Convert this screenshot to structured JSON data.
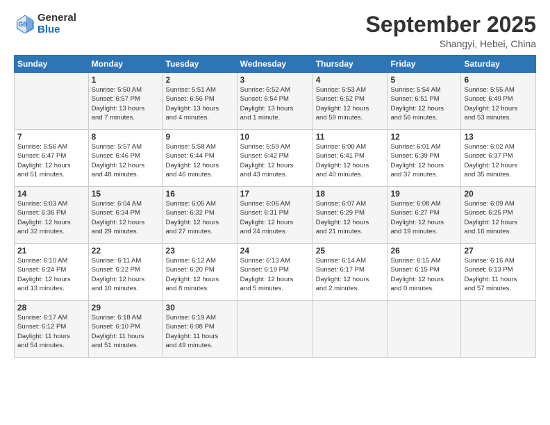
{
  "header": {
    "logo": {
      "general": "General",
      "blue": "Blue"
    },
    "title": "September 2025",
    "subtitle": "Shangyi, Hebei, China"
  },
  "weekdays": [
    "Sunday",
    "Monday",
    "Tuesday",
    "Wednesday",
    "Thursday",
    "Friday",
    "Saturday"
  ],
  "weeks": [
    [
      {
        "day": "",
        "info": ""
      },
      {
        "day": "1",
        "info": "Sunrise: 5:50 AM\nSunset: 6:57 PM\nDaylight: 13 hours\nand 7 minutes."
      },
      {
        "day": "2",
        "info": "Sunrise: 5:51 AM\nSunset: 6:56 PM\nDaylight: 13 hours\nand 4 minutes."
      },
      {
        "day": "3",
        "info": "Sunrise: 5:52 AM\nSunset: 6:54 PM\nDaylight: 13 hours\nand 1 minute."
      },
      {
        "day": "4",
        "info": "Sunrise: 5:53 AM\nSunset: 6:52 PM\nDaylight: 12 hours\nand 59 minutes."
      },
      {
        "day": "5",
        "info": "Sunrise: 5:54 AM\nSunset: 6:51 PM\nDaylight: 12 hours\nand 56 minutes."
      },
      {
        "day": "6",
        "info": "Sunrise: 5:55 AM\nSunset: 6:49 PM\nDaylight: 12 hours\nand 53 minutes."
      }
    ],
    [
      {
        "day": "7",
        "info": "Sunrise: 5:56 AM\nSunset: 6:47 PM\nDaylight: 12 hours\nand 51 minutes."
      },
      {
        "day": "8",
        "info": "Sunrise: 5:57 AM\nSunset: 6:46 PM\nDaylight: 12 hours\nand 48 minutes."
      },
      {
        "day": "9",
        "info": "Sunrise: 5:58 AM\nSunset: 6:44 PM\nDaylight: 12 hours\nand 46 minutes."
      },
      {
        "day": "10",
        "info": "Sunrise: 5:59 AM\nSunset: 6:42 PM\nDaylight: 12 hours\nand 43 minutes."
      },
      {
        "day": "11",
        "info": "Sunrise: 6:00 AM\nSunset: 6:41 PM\nDaylight: 12 hours\nand 40 minutes."
      },
      {
        "day": "12",
        "info": "Sunrise: 6:01 AM\nSunset: 6:39 PM\nDaylight: 12 hours\nand 37 minutes."
      },
      {
        "day": "13",
        "info": "Sunrise: 6:02 AM\nSunset: 6:37 PM\nDaylight: 12 hours\nand 35 minutes."
      }
    ],
    [
      {
        "day": "14",
        "info": "Sunrise: 6:03 AM\nSunset: 6:36 PM\nDaylight: 12 hours\nand 32 minutes."
      },
      {
        "day": "15",
        "info": "Sunrise: 6:04 AM\nSunset: 6:34 PM\nDaylight: 12 hours\nand 29 minutes."
      },
      {
        "day": "16",
        "info": "Sunrise: 6:05 AM\nSunset: 6:32 PM\nDaylight: 12 hours\nand 27 minutes."
      },
      {
        "day": "17",
        "info": "Sunrise: 6:06 AM\nSunset: 6:31 PM\nDaylight: 12 hours\nand 24 minutes."
      },
      {
        "day": "18",
        "info": "Sunrise: 6:07 AM\nSunset: 6:29 PM\nDaylight: 12 hours\nand 21 minutes."
      },
      {
        "day": "19",
        "info": "Sunrise: 6:08 AM\nSunset: 6:27 PM\nDaylight: 12 hours\nand 19 minutes."
      },
      {
        "day": "20",
        "info": "Sunrise: 6:09 AM\nSunset: 6:25 PM\nDaylight: 12 hours\nand 16 minutes."
      }
    ],
    [
      {
        "day": "21",
        "info": "Sunrise: 6:10 AM\nSunset: 6:24 PM\nDaylight: 12 hours\nand 13 minutes."
      },
      {
        "day": "22",
        "info": "Sunrise: 6:11 AM\nSunset: 6:22 PM\nDaylight: 12 hours\nand 10 minutes."
      },
      {
        "day": "23",
        "info": "Sunrise: 6:12 AM\nSunset: 6:20 PM\nDaylight: 12 hours\nand 8 minutes."
      },
      {
        "day": "24",
        "info": "Sunrise: 6:13 AM\nSunset: 6:19 PM\nDaylight: 12 hours\nand 5 minutes."
      },
      {
        "day": "25",
        "info": "Sunrise: 6:14 AM\nSunset: 6:17 PM\nDaylight: 12 hours\nand 2 minutes."
      },
      {
        "day": "26",
        "info": "Sunrise: 6:15 AM\nSunset: 6:15 PM\nDaylight: 12 hours\nand 0 minutes."
      },
      {
        "day": "27",
        "info": "Sunrise: 6:16 AM\nSunset: 6:13 PM\nDaylight: 11 hours\nand 57 minutes."
      }
    ],
    [
      {
        "day": "28",
        "info": "Sunrise: 6:17 AM\nSunset: 6:12 PM\nDaylight: 11 hours\nand 54 minutes."
      },
      {
        "day": "29",
        "info": "Sunrise: 6:18 AM\nSunset: 6:10 PM\nDaylight: 11 hours\nand 51 minutes."
      },
      {
        "day": "30",
        "info": "Sunrise: 6:19 AM\nSunset: 6:08 PM\nDaylight: 11 hours\nand 49 minutes."
      },
      {
        "day": "",
        "info": ""
      },
      {
        "day": "",
        "info": ""
      },
      {
        "day": "",
        "info": ""
      },
      {
        "day": "",
        "info": ""
      }
    ]
  ]
}
